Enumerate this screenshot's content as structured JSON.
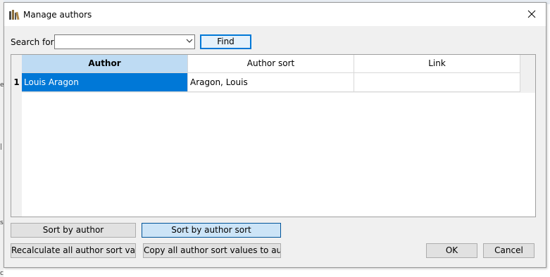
{
  "dialog": {
    "title": "Manage authors",
    "app_icon": "bookshelf-icon",
    "close_icon": "close-icon"
  },
  "search": {
    "label": "Search for:",
    "value": "",
    "find_label": "Find"
  },
  "table": {
    "columns": [
      "Author",
      "Author sort",
      "Link"
    ],
    "rows": [
      {
        "number": "1",
        "author": "Louis Aragon",
        "author_sort": "Aragon, Louis",
        "link": ""
      }
    ]
  },
  "buttons": {
    "sort_by_author": "Sort by author",
    "sort_by_author_sort": "Sort by author sort",
    "recalculate": "Recalculate all author sort values",
    "copy": "Copy all author sort values to author",
    "ok": "OK",
    "cancel": "Cancel"
  },
  "colors": {
    "selection": "#0078d7",
    "header_selected": "#bedbf3",
    "button_active": "#cce4f7"
  }
}
